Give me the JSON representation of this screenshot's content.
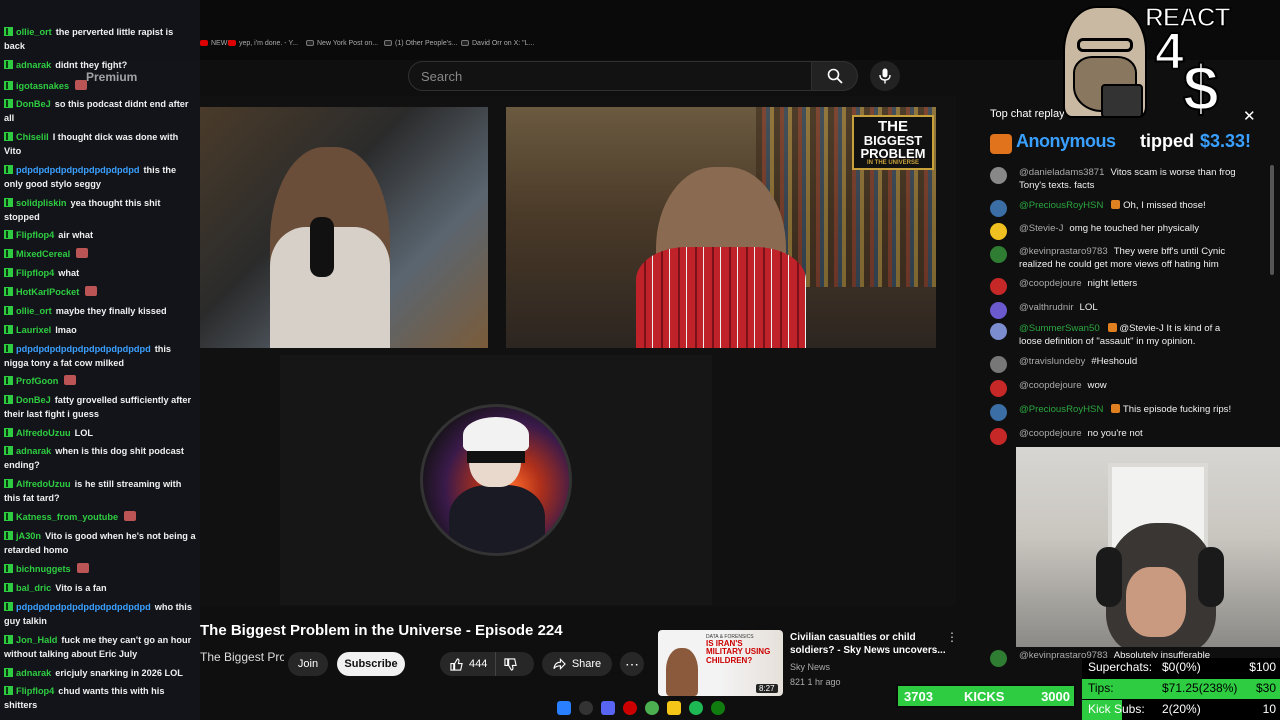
{
  "bookmarks": [
    {
      "label": "NEWS"
    },
    {
      "label": "yep, i'm done. - Y..."
    },
    {
      "label": "New York Post on..."
    },
    {
      "label": "(1) Other People's..."
    },
    {
      "label": "David Orr on X: \"L..."
    }
  ],
  "youtube": {
    "logo_text": "Premium",
    "search_placeholder": "Search"
  },
  "player": {
    "logo_line1": "THE",
    "logo_line2": "BIGGEST PROBLEM",
    "logo_line3": "IN THE UNIVERSE"
  },
  "video": {
    "title": "The Biggest Problem in the Universe - Episode 224",
    "channel": "The Biggest Problem in the Universe",
    "join_label": "Join",
    "subscribe_label": "Subscribe",
    "likes": "444",
    "share_label": "Share"
  },
  "recommended": {
    "thumb_tag": "DATA & FORENSICS",
    "thumb_headline": "IS IRAN'S MILITARY USING CHILDREN?",
    "duration": "8:27",
    "title": "Civilian casualties or child soldiers? - Sky News uncovers...",
    "channel": "Sky News",
    "meta": "821 1 hr ago"
  },
  "left_chat": [
    {
      "user": "ollie_ort",
      "text": "the perverted little rapist is back"
    },
    {
      "user": "adnarak",
      "text": "didnt they fight?"
    },
    {
      "user": "igotasnakes",
      "text": ""
    },
    {
      "user": "DonBeJ",
      "text": "so this podcast didnt end after all"
    },
    {
      "user": "Chiselil",
      "text": "I thought dick was done with Vito"
    },
    {
      "user": "pdpdpdpdpdpdpdpdpdpdpd",
      "text": "this the only good stylo seggy"
    },
    {
      "user": "solidpliskin",
      "text": "yea thought this shit stopped"
    },
    {
      "user": "Flipflop4",
      "text": "air what"
    },
    {
      "user": "MixedCereal",
      "text": ""
    },
    {
      "user": "Flipflop4",
      "text": "what"
    },
    {
      "user": "HotKarlPocket",
      "text": ""
    },
    {
      "user": "ollie_ort",
      "text": "maybe they finally kissed"
    },
    {
      "user": "Laurixel",
      "text": "lmao"
    },
    {
      "user": "pdpdpdpdpdpdpdpdpdpdpdpd",
      "text": "this nigga tony a fat cow milked"
    },
    {
      "user": "ProfGoon",
      "text": ""
    },
    {
      "user": "DonBeJ",
      "text": "fatty grovelled sufficiently after their last fight i guess"
    },
    {
      "user": "AlfredoUzuu",
      "text": "LOL"
    },
    {
      "user": "adnarak",
      "text": "when is this dog shit podcast ending?"
    },
    {
      "user": "AlfredoUzuu",
      "text": "is he still streaming with this fat tard?"
    },
    {
      "user": "Katness_from_youtube",
      "text": ""
    },
    {
      "user": "jA30n",
      "text": "Vito is good when he's not being a retarded homo"
    },
    {
      "user": "bichnuggets",
      "text": ""
    },
    {
      "user": "bal_dric",
      "text": "Vito is a fan"
    },
    {
      "user": "pdpdpdpdpdpdpdpdpdpdpdpd",
      "text": "who this guy talkin"
    },
    {
      "user": "Jon_Hald",
      "text": "fuck me they can't go an hour without talking about Eric July"
    },
    {
      "user": "adnarak",
      "text": "ericjuly snarking in 2026 LOL"
    },
    {
      "user": "Flipflop4",
      "text": "chud wants this with his shitters"
    }
  ],
  "live_chat": {
    "header": "Top chat replay",
    "tip": {
      "user": "Anonymous",
      "verb": "tipped",
      "amount": "$3.33!"
    },
    "messages": [
      {
        "user": "@danieladams3871",
        "text": "Vitos scam is worse than frog Tony's texts. facts",
        "member": false
      },
      {
        "user": "@PreciousRoyHSN",
        "text": "Oh, I missed those!",
        "member": true
      },
      {
        "user": "@Stevie-J",
        "text": "omg he touched her physically",
        "member": false
      },
      {
        "user": "@kevinprastaro9783",
        "text": "They were bff's until Cynic realized he could get more views off hating him",
        "member": false
      },
      {
        "user": "@coopdejoure",
        "text": "night letters",
        "member": false
      },
      {
        "user": "@valthrudnir",
        "text": "LOL",
        "member": false
      },
      {
        "user": "@SummerSwan50",
        "text": "@Stevie-J It is kind of a loose definition of \"assault\" in my opinion.",
        "member": true
      },
      {
        "user": "@travislundeby",
        "text": "#Heshould",
        "member": false
      },
      {
        "user": "@coopdejoure",
        "text": "wow",
        "member": false
      },
      {
        "user": "@PreciousRoyHSN",
        "text": "This episode fucking rips!",
        "member": true
      },
      {
        "user": "@coopdejoure",
        "text": "no you're not",
        "member": false
      },
      {
        "user": "@kevinprastaro9783",
        "text": "Absolutely insufferable",
        "member": false
      }
    ]
  },
  "overlay": {
    "react_text": "REACT",
    "react_four": "4",
    "react_dollar": "$",
    "kicks_count": "3703",
    "kicks_label": "KICKS",
    "kicks_goal": "3000",
    "stats": [
      {
        "label": "Superchats:",
        "value": "$0(0%)",
        "goal": "$100",
        "progress": 0.0
      },
      {
        "label": "Tips:",
        "value": "$71.25(238%)",
        "goal": "$30",
        "progress": 1.0
      },
      {
        "label": "Kick Subs:",
        "value": "2(20%)",
        "goal": "10",
        "progress": 0.2
      }
    ]
  },
  "colors": {
    "accent_green": "#2ecc40",
    "link_blue": "#3aa0ff",
    "member_green": "#2ba640",
    "youtube_red": "#ff0000"
  }
}
